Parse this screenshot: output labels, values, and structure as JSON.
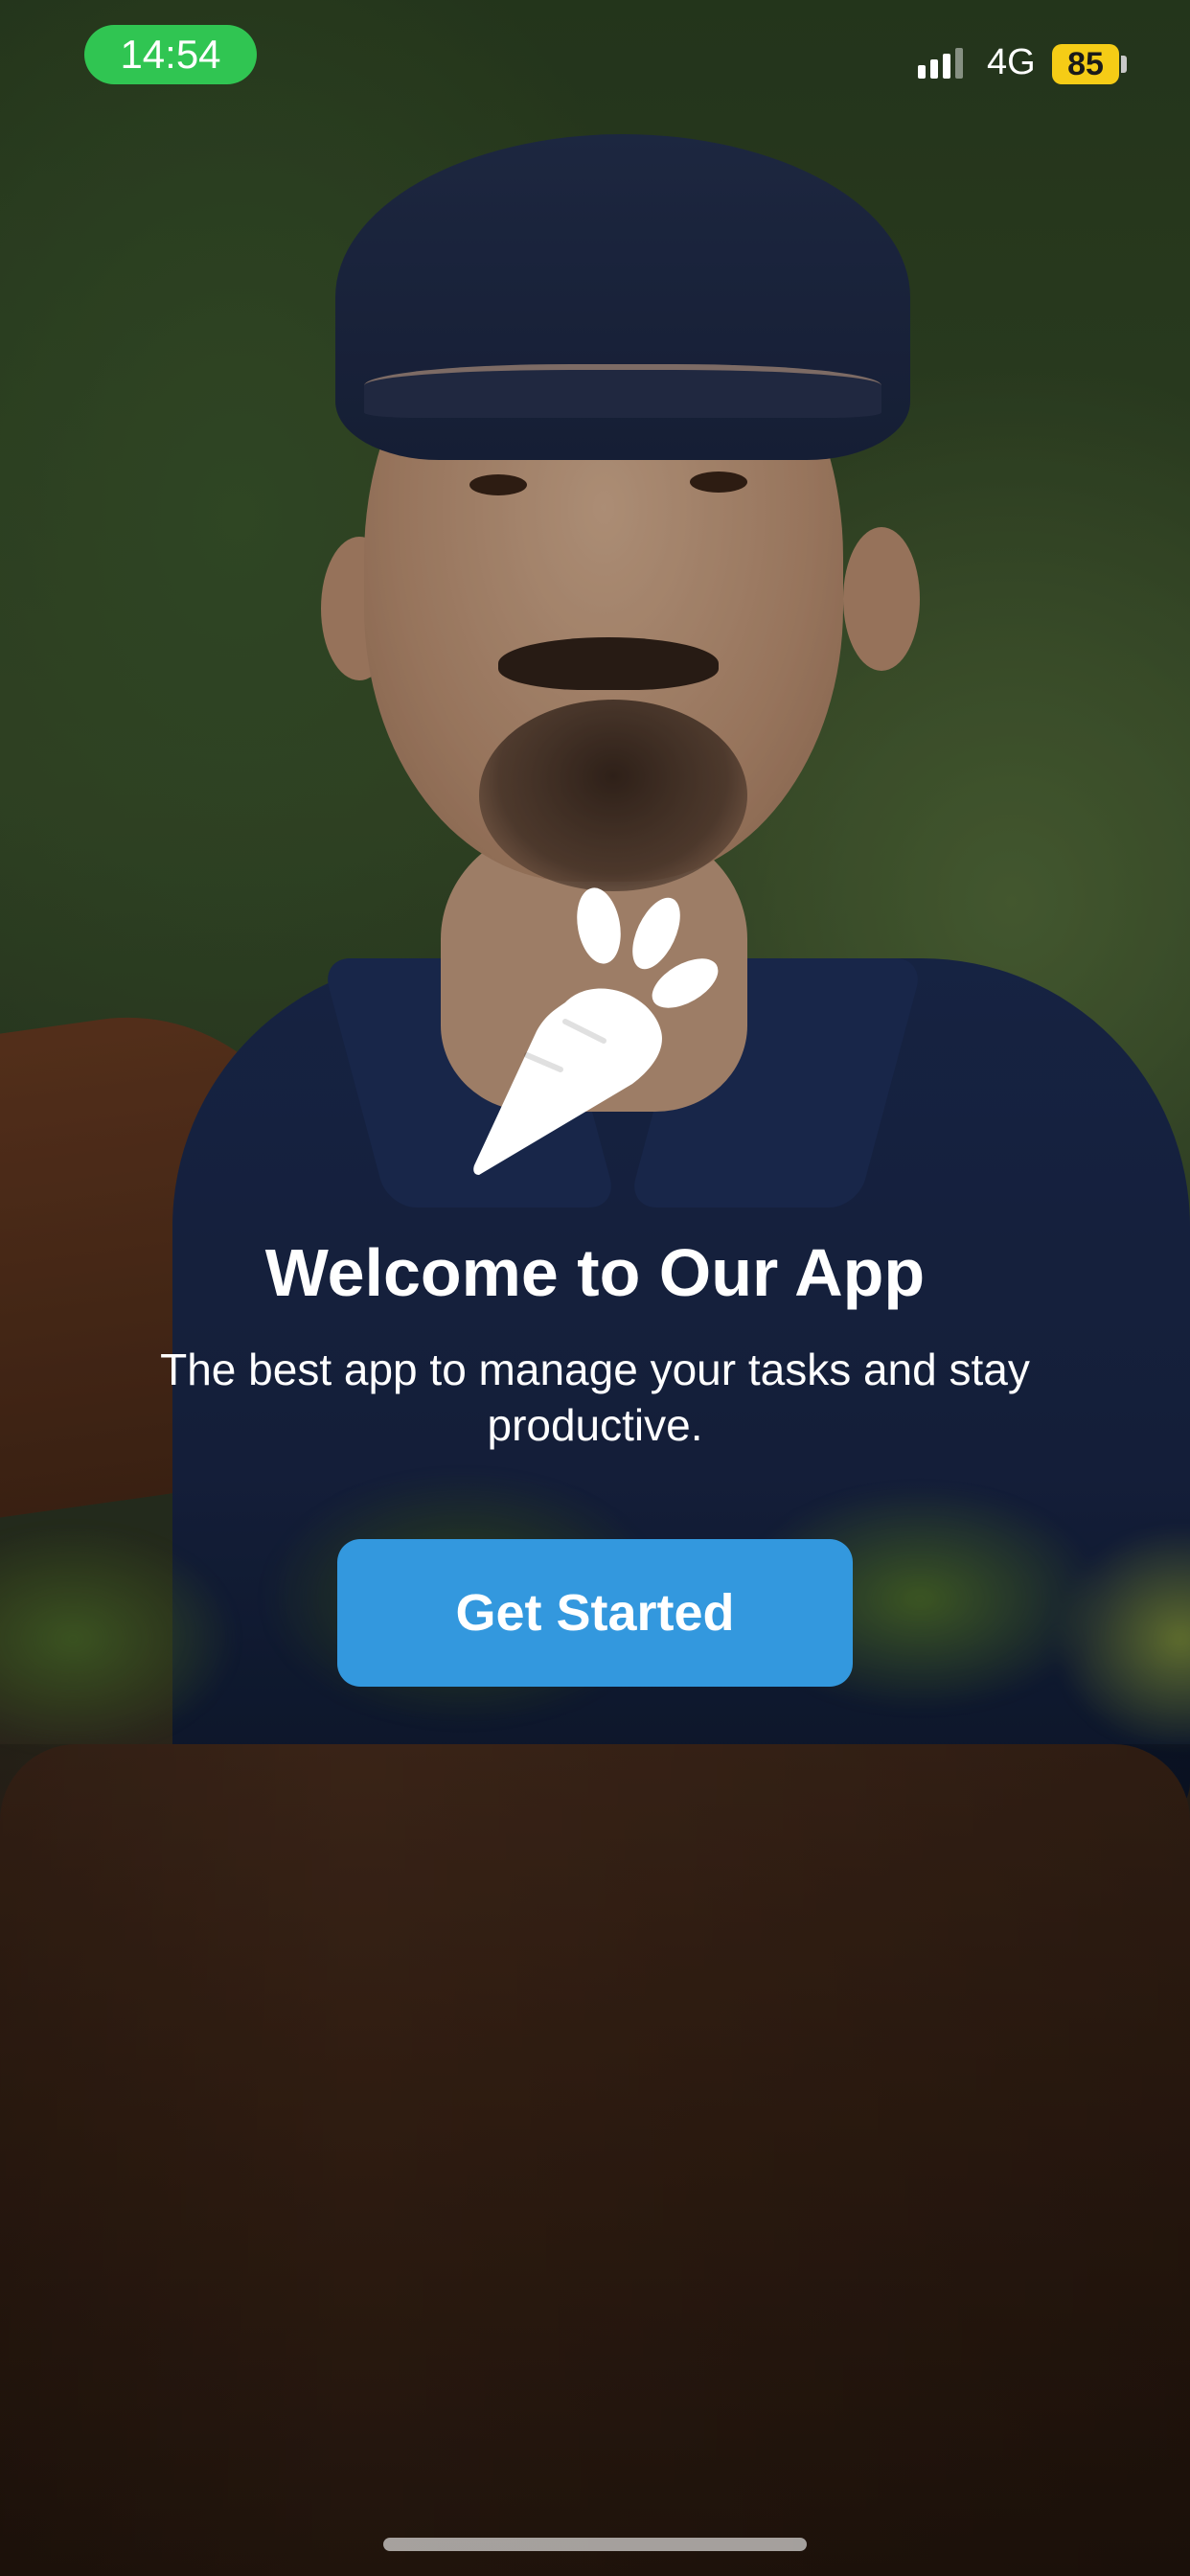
{
  "status_bar": {
    "time": "14:54",
    "network": "4G",
    "battery": "85",
    "battery_color": "#f5cc16",
    "time_pill_color": "#30c552"
  },
  "welcome": {
    "logo_icon": "carrot-icon",
    "title": "Welcome to Our App",
    "subtitle": "The best app to manage your tasks and stay productive.",
    "cta_label": "Get Started",
    "cta_color": "#3398de"
  }
}
